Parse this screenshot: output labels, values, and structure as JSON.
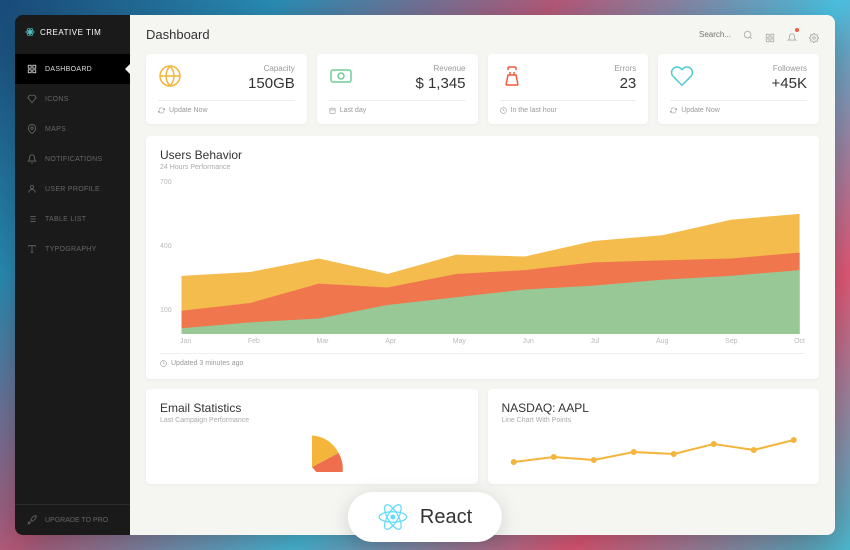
{
  "brand": "CREATIVE TIM",
  "nav": [
    {
      "label": "DASHBOARD",
      "active": true
    },
    {
      "label": "ICONS"
    },
    {
      "label": "MAPS"
    },
    {
      "label": "NOTIFICATIONS"
    },
    {
      "label": "USER PROFILE"
    },
    {
      "label": "TABLE LIST"
    },
    {
      "label": "TYPOGRAPHY"
    }
  ],
  "upgrade": "UPGRADE TO PRO",
  "page_title": "Dashboard",
  "search_placeholder": "Search...",
  "stat_cards": [
    {
      "label": "Capacity",
      "value": "150GB",
      "footer": "Update Now",
      "color": "#f3b53a"
    },
    {
      "label": "Revenue",
      "value": "$ 1,345",
      "footer": "Last day",
      "color": "#6bd098"
    },
    {
      "label": "Errors",
      "value": "23",
      "footer": "In the last hour",
      "color": "#f5593d"
    },
    {
      "label": "Followers",
      "value": "+45K",
      "footer": "Update Now",
      "color": "#51cbce"
    }
  ],
  "behavior": {
    "title": "Users Behavior",
    "subtitle": "24 Hours Performance",
    "footer": "Updated 3 minutes ago"
  },
  "chart_data": {
    "type": "area",
    "title": "Users Behavior",
    "xlabel": "",
    "ylabel": "",
    "ylim": [
      0,
      800
    ],
    "y_ticks": [
      100,
      400,
      700
    ],
    "categories": [
      "Jan",
      "Feb",
      "Mar",
      "Apr",
      "May",
      "Jun",
      "Jul",
      "Aug",
      "Sep",
      "Oct"
    ],
    "series": [
      {
        "name": "orange",
        "color": "#f3b53a",
        "values": [
          300,
          320,
          390,
          310,
          410,
          400,
          480,
          510,
          590,
          620
        ]
      },
      {
        "name": "red",
        "color": "#ef6e4e",
        "values": [
          120,
          160,
          260,
          240,
          310,
          330,
          370,
          380,
          390,
          420
        ]
      },
      {
        "name": "green",
        "color": "#8dd19e",
        "values": [
          30,
          60,
          80,
          150,
          190,
          230,
          250,
          280,
          300,
          330
        ]
      }
    ]
  },
  "email_panel": {
    "title": "Email Statistics",
    "subtitle": "Last Campaign Performance"
  },
  "nasdaq_panel": {
    "title": "NASDAQ: AAPL",
    "subtitle": "Line Chart With Points"
  },
  "react_label": "React"
}
